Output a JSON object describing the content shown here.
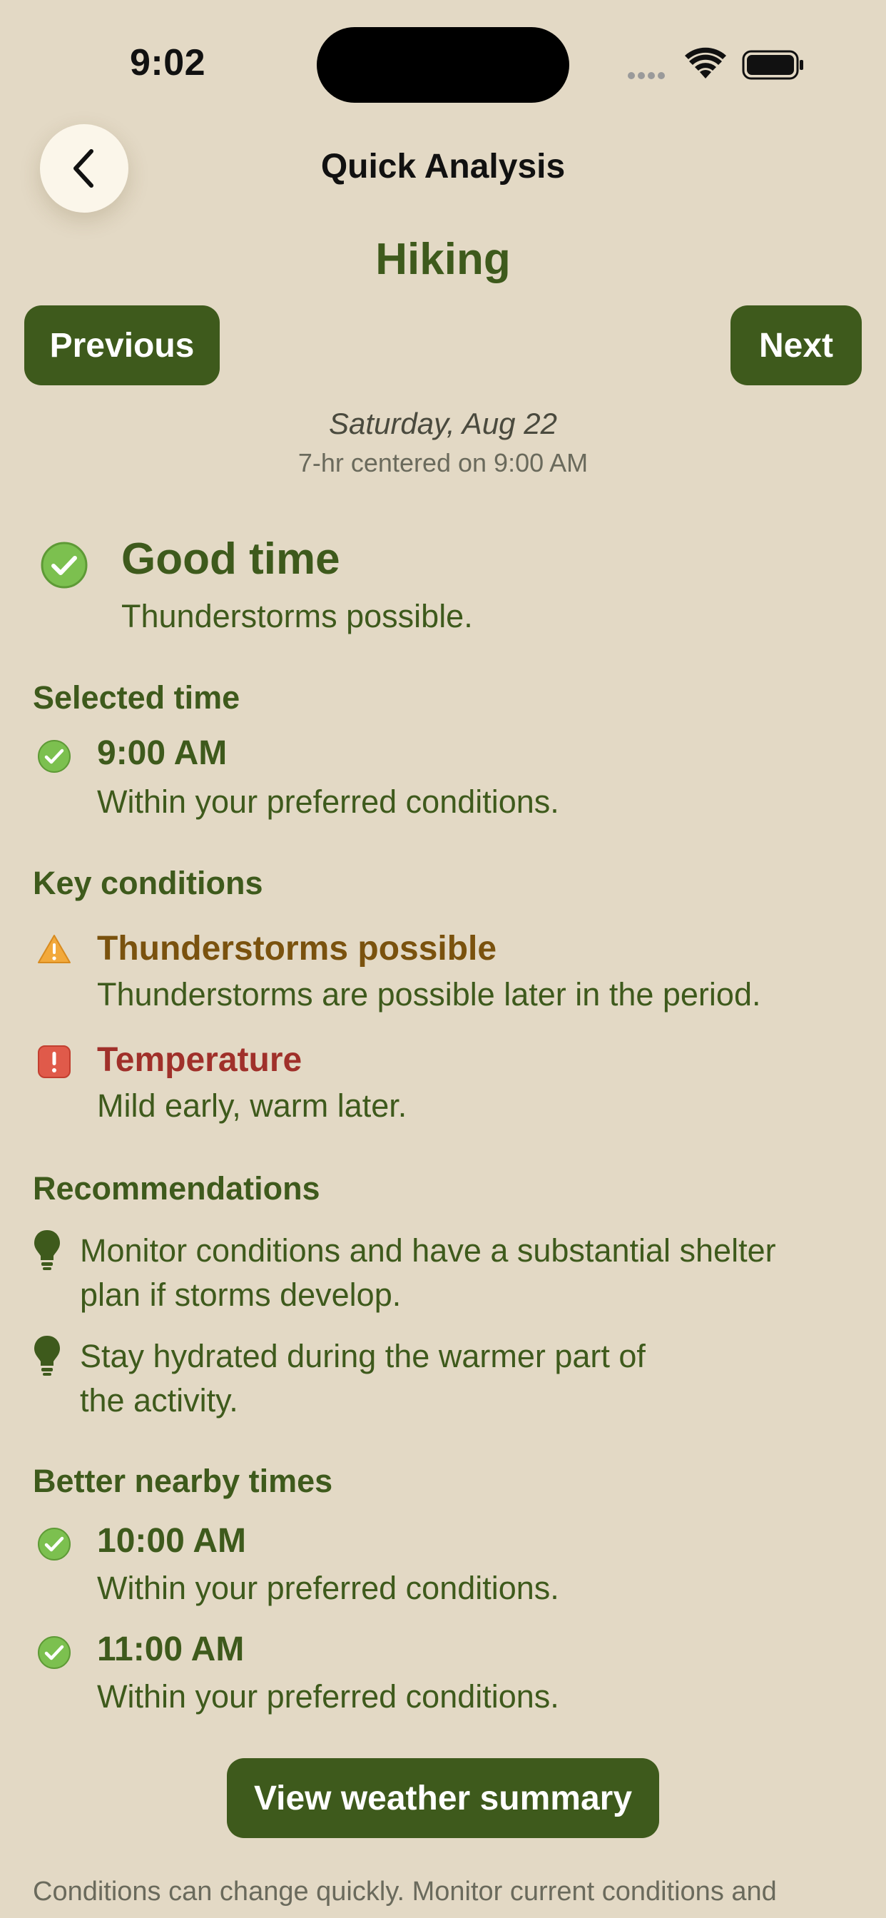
{
  "status_bar": {
    "time": "9:02"
  },
  "header": {
    "title": "Quick Analysis",
    "activity": "Hiking"
  },
  "nav": {
    "previous_label": "Previous",
    "next_label": "Next"
  },
  "period": {
    "date": "Saturday, Aug 22",
    "window": "7-hr centered on 9:00 AM"
  },
  "verdict": {
    "title": "Good time",
    "subtitle": "Thunderstorms possible.",
    "icon": "check-circle-icon"
  },
  "selected_time": {
    "heading": "Selected time",
    "time": "9:00 AM",
    "note": "Within your preferred conditions.",
    "icon": "check-circle-icon"
  },
  "key_conditions": {
    "heading": "Key conditions",
    "items": [
      {
        "title": "Thunderstorms possible",
        "desc": "Thunderstorms are possible later in the period.",
        "icon": "warning-triangle-icon",
        "color": "#7a520e"
      },
      {
        "title": "Temperature",
        "desc": "Mild early, warm later.",
        "icon": "exclamation-square-icon",
        "color": "#a0302a"
      }
    ]
  },
  "recommendations": {
    "heading": "Recommendations",
    "items": [
      {
        "line1": "Monitor conditions and have a substantial shelter",
        "line2": "plan if storms develop.",
        "icon": "lightbulb-icon"
      },
      {
        "line1": "Stay hydrated during the warmer part of",
        "line2": "the activity.",
        "icon": "lightbulb-icon"
      }
    ]
  },
  "better_times": {
    "heading": "Better nearby times",
    "items": [
      {
        "time": "10:00 AM",
        "note": "Within your preferred conditions.",
        "icon": "check-circle-icon"
      },
      {
        "time": "11:00 AM",
        "note": "Within your preferred conditions.",
        "icon": "check-circle-icon"
      }
    ]
  },
  "cta": {
    "label": "View weather summary"
  },
  "footer": {
    "text": "Conditions can change quickly. Monitor current conditions and"
  },
  "colors": {
    "background": "#e3d9c5",
    "primary": "#3e5a1c",
    "warning": "#7a520e",
    "alert": "#a0302a",
    "check": "#7cc04f"
  }
}
